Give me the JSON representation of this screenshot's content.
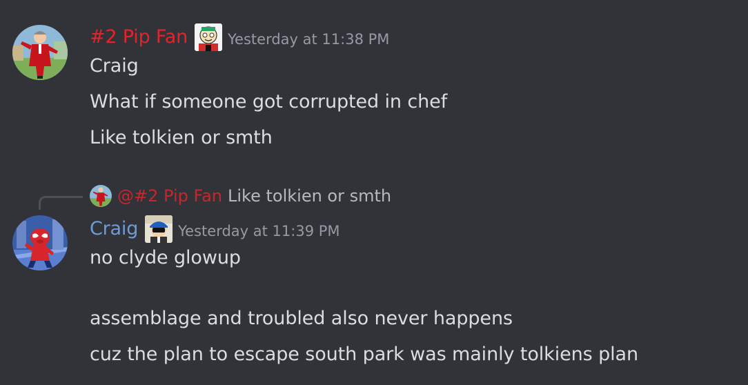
{
  "colors": {
    "background": "#313338",
    "pip_fan_name": "#e3242b",
    "craig_name": "#6f9bd9",
    "text": "#dbdee1",
    "muted": "#949ba4"
  },
  "messages": [
    {
      "author": "#2 Pip Fan",
      "timestamp": "Yesterday at 11:38 PM",
      "avatar_icon": "man-in-red-suit-avatar",
      "badge_icon": "cartoon-character-badge-icon",
      "lines": [
        "Craig",
        "What if someone got corrupted in chef",
        "Like tolkien or smth"
      ]
    },
    {
      "reply": {
        "mention": "@#2 Pip Fan",
        "content": "Like tolkien or smth"
      },
      "author": "Craig",
      "timestamp": "Yesterday at 11:39 PM",
      "avatar_icon": "spider-ham-avatar",
      "badge_icon": "blue-hat-character-badge-icon",
      "lines": [
        "no clyde glowup",
        "",
        "assemblage and troubled also never happens",
        "cuz the plan to escape south park was mainly tolkiens plan"
      ]
    }
  ]
}
